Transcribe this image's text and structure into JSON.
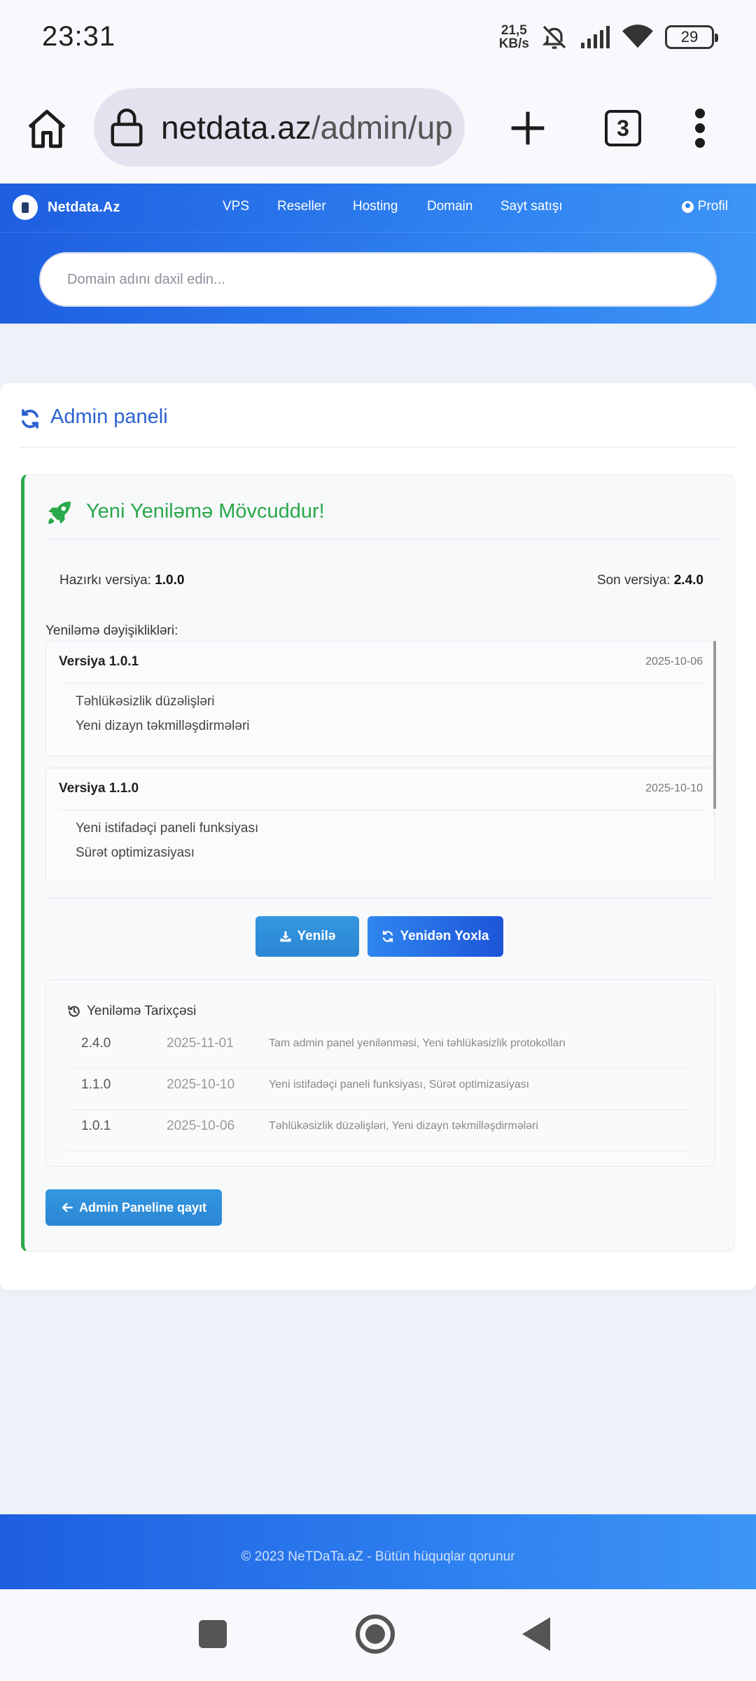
{
  "status_bar": {
    "time": "23:31",
    "net_speed_value": "21,5",
    "net_speed_unit": "KB/s",
    "battery": "29",
    "icons": [
      "bell-off-icon",
      "signal-icon",
      "wifi-icon",
      "battery-icon"
    ]
  },
  "browser": {
    "url_host": "netdata.az",
    "url_path": "/admin/up",
    "tab_count": "3"
  },
  "nav": {
    "brand": "Netdata.Az",
    "links": [
      "VPS",
      "Reseller",
      "Hosting",
      "Domain",
      "Sayt satışı"
    ],
    "profile": "Profil"
  },
  "search": {
    "placeholder": "Domain adını daxil edin..."
  },
  "card": {
    "title": "Admin paneli"
  },
  "update": {
    "title": "Yeni Yeniləmə Mövcuddur!",
    "current_label": "Hazırkı versiya:",
    "current_version": "1.0.0",
    "latest_label": "Son versiya:",
    "latest_version": "2.4.0",
    "changes_label": "Yeniləmə dəyişiklikləri:",
    "changes": [
      {
        "title": "Versiya 1.0.1",
        "date": "2025-10-06",
        "items": [
          "Təhlükəsizlik düzəlişləri",
          "Yeni dizayn təkmilləşdirmələri"
        ]
      },
      {
        "title": "Versiya 1.1.0",
        "date": "2025-10-10",
        "items": [
          "Yeni istifadəçi paneli funksiyası",
          "Sürət optimizasiyası"
        ]
      }
    ],
    "update_button": "Yenilə",
    "recheck_button": "Yenidən Yoxla"
  },
  "history": {
    "title": "Yeniləmə Tarixçəsi",
    "rows": [
      {
        "version": "2.4.0",
        "date": "2025-11-01",
        "notes": "Tam admin panel yenilənməsi, Yeni təhlükəsizlik protokolları"
      },
      {
        "version": "1.1.0",
        "date": "2025-10-10",
        "notes": "Yeni istifadəçi paneli funksiyası, Sürət optimizasiyası"
      },
      {
        "version": "1.0.1",
        "date": "2025-10-06",
        "notes": "Təhlükəsizlik düzəlişləri, Yeni dizayn təkmilləşdirmələri"
      }
    ]
  },
  "back_button": "Admin Paneline qayıt",
  "footer": {
    "text": "© 2023 NeTDaTa.aZ - Bütün hüquqlar qorunur"
  },
  "colors": {
    "primary_blue": "#2e80f0",
    "success_green": "#2aa84a",
    "title_blue": "#2b62d0"
  }
}
